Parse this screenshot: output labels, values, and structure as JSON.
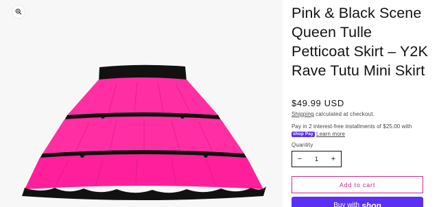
{
  "product": {
    "title": "Pink & Black Scene Queen Tulle Petticoat Skirt – Y2K Rave Tutu Mini Skirt",
    "price": "$49.99 USD",
    "shipping_link": "Shipping",
    "shipping_suffix": " calculated at checkout.",
    "installments_text": "Pay in 2 interest-free installments of $25.00 with",
    "shoppay_badge": "shop Pay",
    "learn_more": "Learn more",
    "quantity_label": "Quantity",
    "quantity_value": "1",
    "decrement_symbol": "−",
    "increment_symbol": "+",
    "add_to_cart_label": "Add to cart",
    "buy_with_label": "Buy with",
    "buy_with_logo": "shop"
  },
  "media": {
    "zoom_icon": "zoom-icon"
  },
  "colors": {
    "accent_pink": "#cf2a86",
    "shop_purple": "#5a31f4",
    "skirt_pink": "#ff2fa3",
    "skirt_black": "#111111"
  }
}
